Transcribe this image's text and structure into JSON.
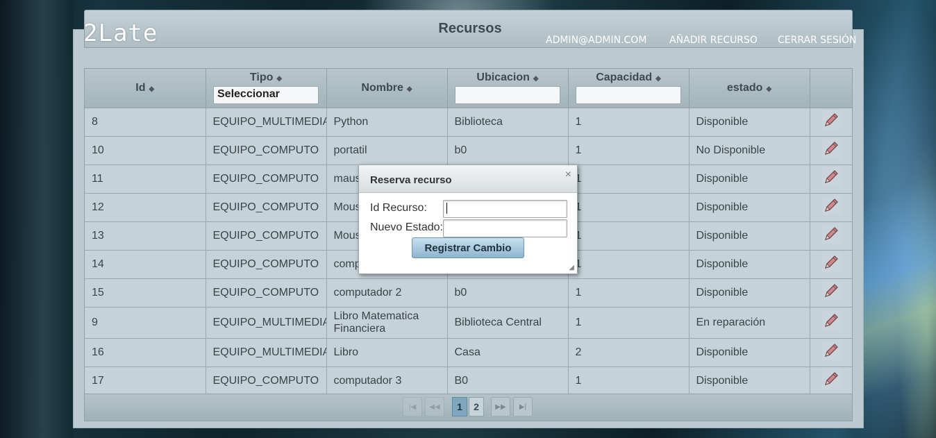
{
  "app": {
    "logo": "2Late",
    "title": "Recursos"
  },
  "nav": {
    "user": "ADMIN@ADMIN.COM",
    "add_resource": "AÑADIR RECURSO",
    "logout": "CERRAR SESIÓN"
  },
  "table": {
    "columns": [
      "Id",
      "Tipo",
      "Nombre",
      "Ubicacion",
      "Capacidad",
      "estado"
    ],
    "filters": {
      "tipo_selected": "Seleccionar",
      "ubicacion": "",
      "capacidad": ""
    },
    "rows": [
      {
        "id": "8",
        "tipo": "EQUIPO_MULTIMEDIA",
        "nombre": "Python",
        "ubicacion": "Biblioteca",
        "capacidad": "1",
        "estado": "Disponible"
      },
      {
        "id": "10",
        "tipo": "EQUIPO_COMPUTO",
        "nombre": "portatil",
        "ubicacion": "b0",
        "capacidad": "1",
        "estado": "No Disponible"
      },
      {
        "id": "11",
        "tipo": "EQUIPO_COMPUTO",
        "nombre": "maus",
        "ubicacion": "",
        "capacidad": "1",
        "estado": "Disponible"
      },
      {
        "id": "12",
        "tipo": "EQUIPO_COMPUTO",
        "nombre": "Mous",
        "ubicacion": "",
        "capacidad": "1",
        "estado": "Disponible"
      },
      {
        "id": "13",
        "tipo": "EQUIPO_COMPUTO",
        "nombre": "Mous",
        "ubicacion": "",
        "capacidad": "1",
        "estado": "Disponible"
      },
      {
        "id": "14",
        "tipo": "EQUIPO_COMPUTO",
        "nombre": "comp",
        "ubicacion": "",
        "capacidad": "1",
        "estado": "Disponible"
      },
      {
        "id": "15",
        "tipo": "EQUIPO_COMPUTO",
        "nombre": "computador 2",
        "ubicacion": "b0",
        "capacidad": "1",
        "estado": "Disponible"
      },
      {
        "id": "9",
        "tipo": "EQUIPO_MULTIMEDIA",
        "nombre": "Libro Matematica Financiera",
        "ubicacion": "Biblioteca Central",
        "capacidad": "1",
        "estado": "En reparación"
      },
      {
        "id": "16",
        "tipo": "EQUIPO_MULTIMEDIA",
        "nombre": "Libro",
        "ubicacion": "Casa",
        "capacidad": "2",
        "estado": "Disponible"
      },
      {
        "id": "17",
        "tipo": "EQUIPO_COMPUTO",
        "nombre": "computador 3",
        "ubicacion": "B0",
        "capacidad": "1",
        "estado": "Disponible"
      }
    ]
  },
  "pager": {
    "pages": [
      "1",
      "2"
    ],
    "current": "1"
  },
  "dialog": {
    "title": "Reserva recurso",
    "close": "×",
    "id_label": "Id Recurso:",
    "estado_label": "Nuevo Estado:",
    "id_value": "",
    "estado_value": "",
    "submit": "Registrar Cambio"
  },
  "icons": {
    "edit": "pencil-icon",
    "close": "close-icon"
  }
}
